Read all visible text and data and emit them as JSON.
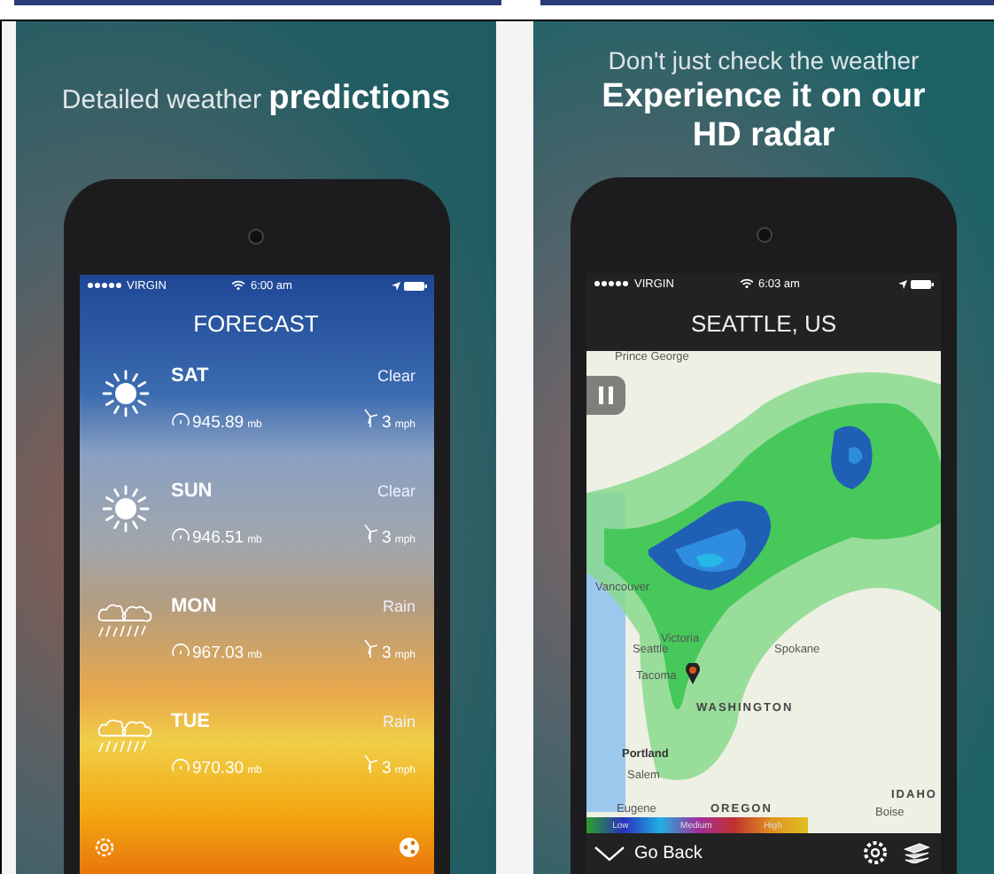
{
  "forecast_panel": {
    "caption": "Detailed weather **predictions**",
    "status_bar": {
      "carrier": "VIRGIN",
      "time": "6:00 am"
    },
    "title": "FORECAST",
    "days": [
      {
        "kind": "sun",
        "day": "SAT",
        "condition": "Clear",
        "pressure": "945.89",
        "pressure_unit": "mb",
        "wind": "3",
        "wind_unit": "mph"
      },
      {
        "kind": "sun",
        "day": "SUN",
        "condition": "Clear",
        "pressure": "946.51",
        "pressure_unit": "mb",
        "wind": "3",
        "wind_unit": "mph"
      },
      {
        "kind": "rain",
        "day": "MON",
        "condition": "Rain",
        "pressure": "967.03",
        "pressure_unit": "mb",
        "wind": "3",
        "wind_unit": "mph"
      },
      {
        "kind": "rain",
        "day": "TUE",
        "condition": "Rain",
        "pressure": "970.30",
        "pressure_unit": "mb",
        "wind": "3",
        "wind_unit": "mph"
      }
    ]
  },
  "radar_panel": {
    "caption": "Don't just check the weather",
    "headline": "Experience it on our HD radar",
    "status_bar": {
      "carrier": "VIRGIN",
      "time": "6:03 am"
    },
    "title": "SEATTLE, US",
    "map_labels": [
      {
        "kind": "city",
        "text": "Prince George"
      },
      {
        "kind": "city",
        "text": "Vancouver"
      },
      {
        "kind": "city",
        "text": "Victoria"
      },
      {
        "kind": "city",
        "text": "Seattle"
      },
      {
        "kind": "city",
        "text": "Tacoma"
      },
      {
        "kind": "city",
        "text": "Spokane"
      },
      {
        "kind": "region",
        "text": "WASHINGTON"
      },
      {
        "kind": "major",
        "text": "Portland"
      },
      {
        "kind": "city",
        "text": "Salem"
      },
      {
        "kind": "city",
        "text": "Eugene"
      },
      {
        "kind": "region",
        "text": "OREGON"
      },
      {
        "kind": "region",
        "text": "IDAHO"
      },
      {
        "kind": "city",
        "text": "Boise"
      }
    ],
    "legend": [
      "Low",
      "Medium",
      "High"
    ],
    "back_label": "Go Back"
  }
}
